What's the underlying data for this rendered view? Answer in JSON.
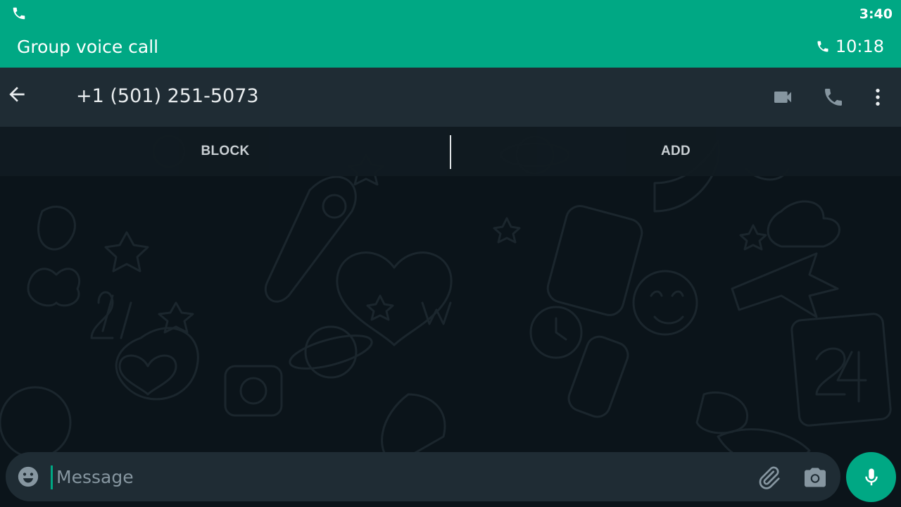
{
  "status_bar": {
    "time": "3:40",
    "call_icon": "phone-icon"
  },
  "call_banner": {
    "label": "Group voice call",
    "timer": "10:18",
    "icon": "phone-icon"
  },
  "toolbar": {
    "back_icon": "arrow-left-icon",
    "contact_name": "+1 (501) 251-5073",
    "video_icon": "video-camera-icon",
    "voice_icon": "phone-icon",
    "menu_icon": "more-vertical-icon"
  },
  "actions": {
    "block_label": "BLOCK",
    "add_label": "ADD"
  },
  "composer": {
    "placeholder": "Message",
    "emoji_icon": "emoji-icon",
    "attach_icon": "paperclip-icon",
    "camera_icon": "camera-icon",
    "mic_icon": "microphone-icon"
  },
  "colors": {
    "accent": "#00a884",
    "toolbar_bg": "#1f2c34",
    "chat_bg": "#0b141a",
    "icon_gray": "#8696a0",
    "text": "#e9edef"
  }
}
